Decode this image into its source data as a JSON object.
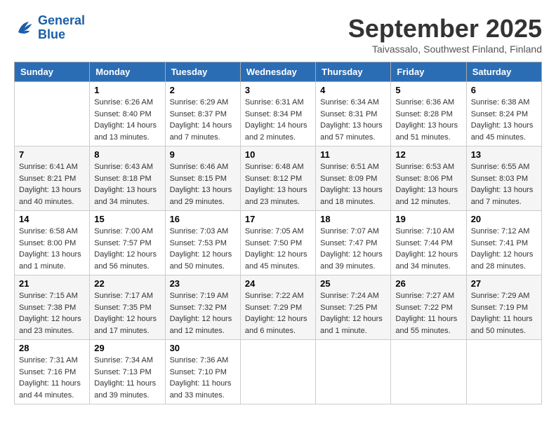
{
  "logo": {
    "line1": "General",
    "line2": "Blue"
  },
  "title": "September 2025",
  "location": "Taivassalo, Southwest Finland, Finland",
  "headers": [
    "Sunday",
    "Monday",
    "Tuesday",
    "Wednesday",
    "Thursday",
    "Friday",
    "Saturday"
  ],
  "weeks": [
    [
      {
        "day": "",
        "info": ""
      },
      {
        "day": "1",
        "info": "Sunrise: 6:26 AM\nSunset: 8:40 PM\nDaylight: 14 hours\nand 13 minutes."
      },
      {
        "day": "2",
        "info": "Sunrise: 6:29 AM\nSunset: 8:37 PM\nDaylight: 14 hours\nand 7 minutes."
      },
      {
        "day": "3",
        "info": "Sunrise: 6:31 AM\nSunset: 8:34 PM\nDaylight: 14 hours\nand 2 minutes."
      },
      {
        "day": "4",
        "info": "Sunrise: 6:34 AM\nSunset: 8:31 PM\nDaylight: 13 hours\nand 57 minutes."
      },
      {
        "day": "5",
        "info": "Sunrise: 6:36 AM\nSunset: 8:28 PM\nDaylight: 13 hours\nand 51 minutes."
      },
      {
        "day": "6",
        "info": "Sunrise: 6:38 AM\nSunset: 8:24 PM\nDaylight: 13 hours\nand 45 minutes."
      }
    ],
    [
      {
        "day": "7",
        "info": "Sunrise: 6:41 AM\nSunset: 8:21 PM\nDaylight: 13 hours\nand 40 minutes."
      },
      {
        "day": "8",
        "info": "Sunrise: 6:43 AM\nSunset: 8:18 PM\nDaylight: 13 hours\nand 34 minutes."
      },
      {
        "day": "9",
        "info": "Sunrise: 6:46 AM\nSunset: 8:15 PM\nDaylight: 13 hours\nand 29 minutes."
      },
      {
        "day": "10",
        "info": "Sunrise: 6:48 AM\nSunset: 8:12 PM\nDaylight: 13 hours\nand 23 minutes."
      },
      {
        "day": "11",
        "info": "Sunrise: 6:51 AM\nSunset: 8:09 PM\nDaylight: 13 hours\nand 18 minutes."
      },
      {
        "day": "12",
        "info": "Sunrise: 6:53 AM\nSunset: 8:06 PM\nDaylight: 13 hours\nand 12 minutes."
      },
      {
        "day": "13",
        "info": "Sunrise: 6:55 AM\nSunset: 8:03 PM\nDaylight: 13 hours\nand 7 minutes."
      }
    ],
    [
      {
        "day": "14",
        "info": "Sunrise: 6:58 AM\nSunset: 8:00 PM\nDaylight: 13 hours\nand 1 minute."
      },
      {
        "day": "15",
        "info": "Sunrise: 7:00 AM\nSunset: 7:57 PM\nDaylight: 12 hours\nand 56 minutes."
      },
      {
        "day": "16",
        "info": "Sunrise: 7:03 AM\nSunset: 7:53 PM\nDaylight: 12 hours\nand 50 minutes."
      },
      {
        "day": "17",
        "info": "Sunrise: 7:05 AM\nSunset: 7:50 PM\nDaylight: 12 hours\nand 45 minutes."
      },
      {
        "day": "18",
        "info": "Sunrise: 7:07 AM\nSunset: 7:47 PM\nDaylight: 12 hours\nand 39 minutes."
      },
      {
        "day": "19",
        "info": "Sunrise: 7:10 AM\nSunset: 7:44 PM\nDaylight: 12 hours\nand 34 minutes."
      },
      {
        "day": "20",
        "info": "Sunrise: 7:12 AM\nSunset: 7:41 PM\nDaylight: 12 hours\nand 28 minutes."
      }
    ],
    [
      {
        "day": "21",
        "info": "Sunrise: 7:15 AM\nSunset: 7:38 PM\nDaylight: 12 hours\nand 23 minutes."
      },
      {
        "day": "22",
        "info": "Sunrise: 7:17 AM\nSunset: 7:35 PM\nDaylight: 12 hours\nand 17 minutes."
      },
      {
        "day": "23",
        "info": "Sunrise: 7:19 AM\nSunset: 7:32 PM\nDaylight: 12 hours\nand 12 minutes."
      },
      {
        "day": "24",
        "info": "Sunrise: 7:22 AM\nSunset: 7:29 PM\nDaylight: 12 hours\nand 6 minutes."
      },
      {
        "day": "25",
        "info": "Sunrise: 7:24 AM\nSunset: 7:25 PM\nDaylight: 12 hours\nand 1 minute."
      },
      {
        "day": "26",
        "info": "Sunrise: 7:27 AM\nSunset: 7:22 PM\nDaylight: 11 hours\nand 55 minutes."
      },
      {
        "day": "27",
        "info": "Sunrise: 7:29 AM\nSunset: 7:19 PM\nDaylight: 11 hours\nand 50 minutes."
      }
    ],
    [
      {
        "day": "28",
        "info": "Sunrise: 7:31 AM\nSunset: 7:16 PM\nDaylight: 11 hours\nand 44 minutes."
      },
      {
        "day": "29",
        "info": "Sunrise: 7:34 AM\nSunset: 7:13 PM\nDaylight: 11 hours\nand 39 minutes."
      },
      {
        "day": "30",
        "info": "Sunrise: 7:36 AM\nSunset: 7:10 PM\nDaylight: 11 hours\nand 33 minutes."
      },
      {
        "day": "",
        "info": ""
      },
      {
        "day": "",
        "info": ""
      },
      {
        "day": "",
        "info": ""
      },
      {
        "day": "",
        "info": ""
      }
    ]
  ]
}
